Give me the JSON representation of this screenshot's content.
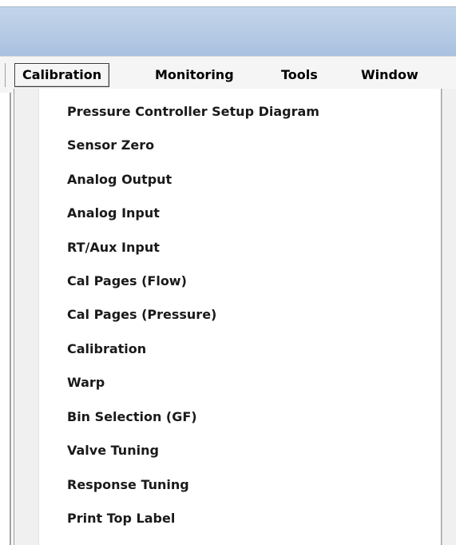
{
  "menu_bar": {
    "items": [
      "Calibration",
      "Monitoring",
      "Tools",
      "Window"
    ],
    "active_index": 0
  },
  "dropdown": {
    "items": [
      "Pressure Controller Setup Diagram",
      "Sensor Zero",
      "Analog Output",
      "Analog Input",
      "RT/Aux Input",
      "Cal Pages (Flow)",
      "Cal Pages (Pressure)",
      "Calibration",
      "Warp",
      "Bin Selection (GF)",
      "Valve Tuning",
      "Response Tuning",
      "Print Top Label"
    ]
  },
  "colors": {
    "title_bar": "#b7cbe5",
    "menu_bar_bg": "#f5f5f5",
    "dropdown_bg": "#ffffff",
    "gutter_bg": "#f0f0f0"
  }
}
